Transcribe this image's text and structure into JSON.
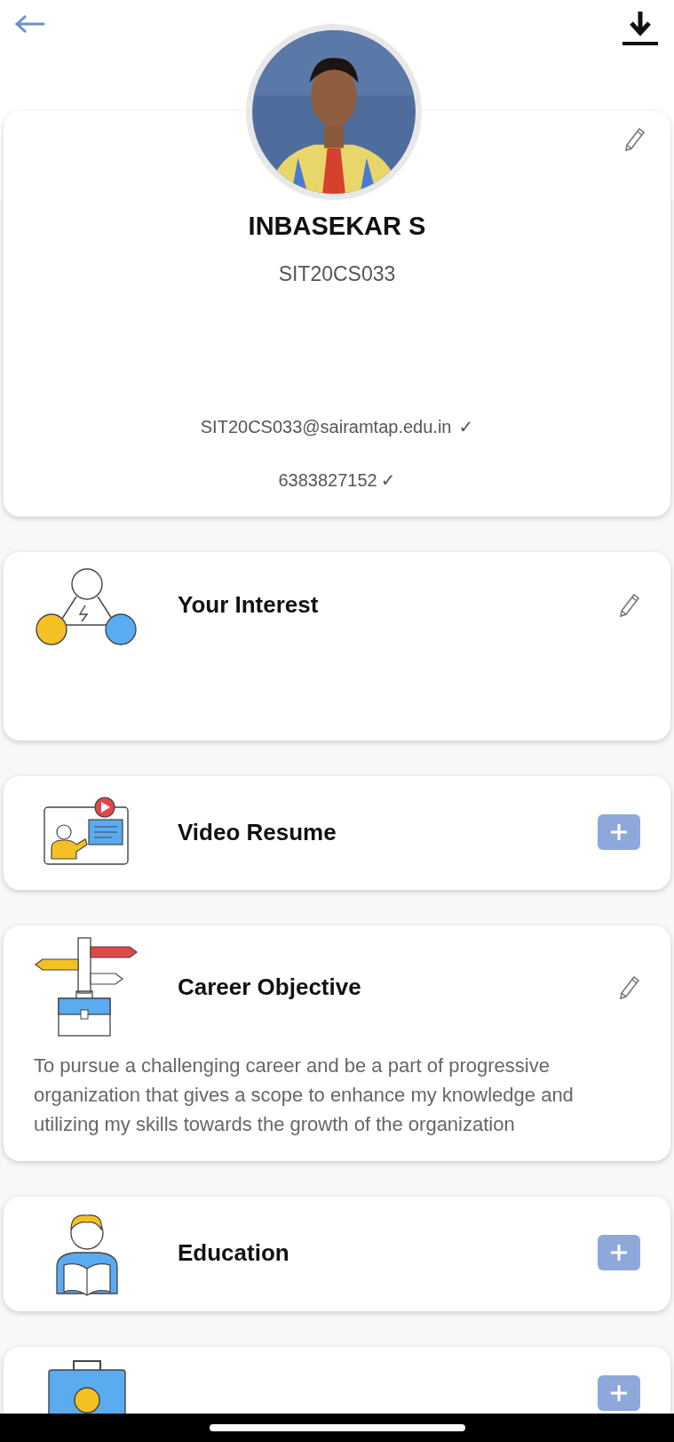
{
  "profile": {
    "name": "INBASEKAR S",
    "register_no": "SIT20CS033",
    "email": "SIT20CS033@sairamtap.edu.in",
    "email_mark": "✓",
    "phone": "6383827152",
    "phone_mark": "✓"
  },
  "sections": [
    {
      "kind": "interest",
      "title": "Your Interest",
      "action": {
        "kind": "edit"
      }
    },
    {
      "kind": "video",
      "title": "Video Resume",
      "action": {
        "kind": "add"
      }
    },
    {
      "kind": "career",
      "title": "Career Objective",
      "action": {
        "kind": "edit"
      },
      "text": "To pursue a challenging career and be a part of progressive organization that gives a scope to enhance my knowledge and utilizing my skills towards the growth of the organization"
    },
    {
      "kind": "education",
      "title": "Education",
      "action": {
        "kind": "add"
      }
    },
    {
      "kind": "experience",
      "action": {
        "kind": "add"
      }
    }
  ]
}
